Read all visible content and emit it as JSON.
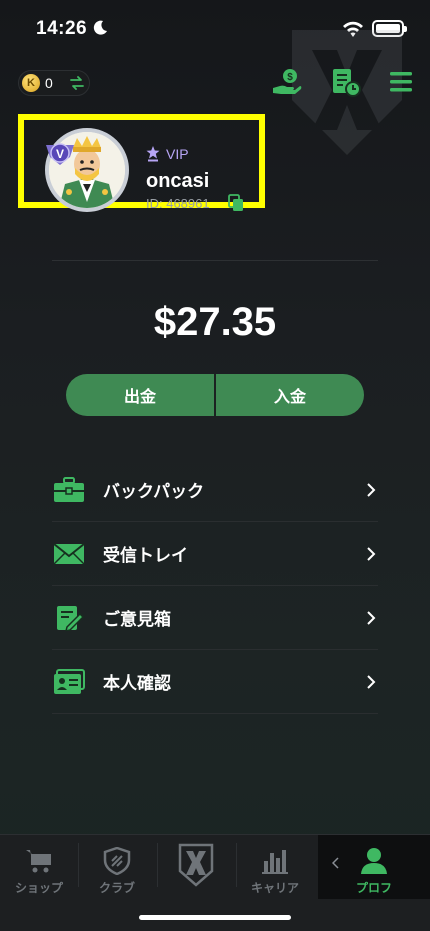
{
  "status_bar": {
    "time": "14:26"
  },
  "header": {
    "coin_count": "0",
    "coin_symbol": "K"
  },
  "profile": {
    "vip_label": "VIP",
    "username": "oncasi",
    "id_label": "ID: 468961"
  },
  "wallet": {
    "balance": "$27.35",
    "withdraw_label": "出金",
    "deposit_label": "入金"
  },
  "menu": {
    "items": [
      {
        "label": "バックパック",
        "icon": "briefcase-icon"
      },
      {
        "label": "受信トレイ",
        "icon": "envelope-icon"
      },
      {
        "label": "ご意見箱",
        "icon": "feedback-icon"
      },
      {
        "label": "本人確認",
        "icon": "id-card-icon"
      }
    ]
  },
  "tabbar": {
    "tabs": [
      {
        "label": "ショップ",
        "icon": "cart-icon"
      },
      {
        "label": "クラブ",
        "icon": "shield-icon"
      },
      {
        "label": "",
        "icon": "crest-icon"
      },
      {
        "label": "キャリア",
        "icon": "bar-chart-icon"
      },
      {
        "label": "プロフ",
        "icon": "person-icon"
      }
    ]
  },
  "colors": {
    "accent": "#3f8a53",
    "accent_bright": "#3fb862",
    "highlight": "#ffff00",
    "vip": "#b7a5f5"
  }
}
